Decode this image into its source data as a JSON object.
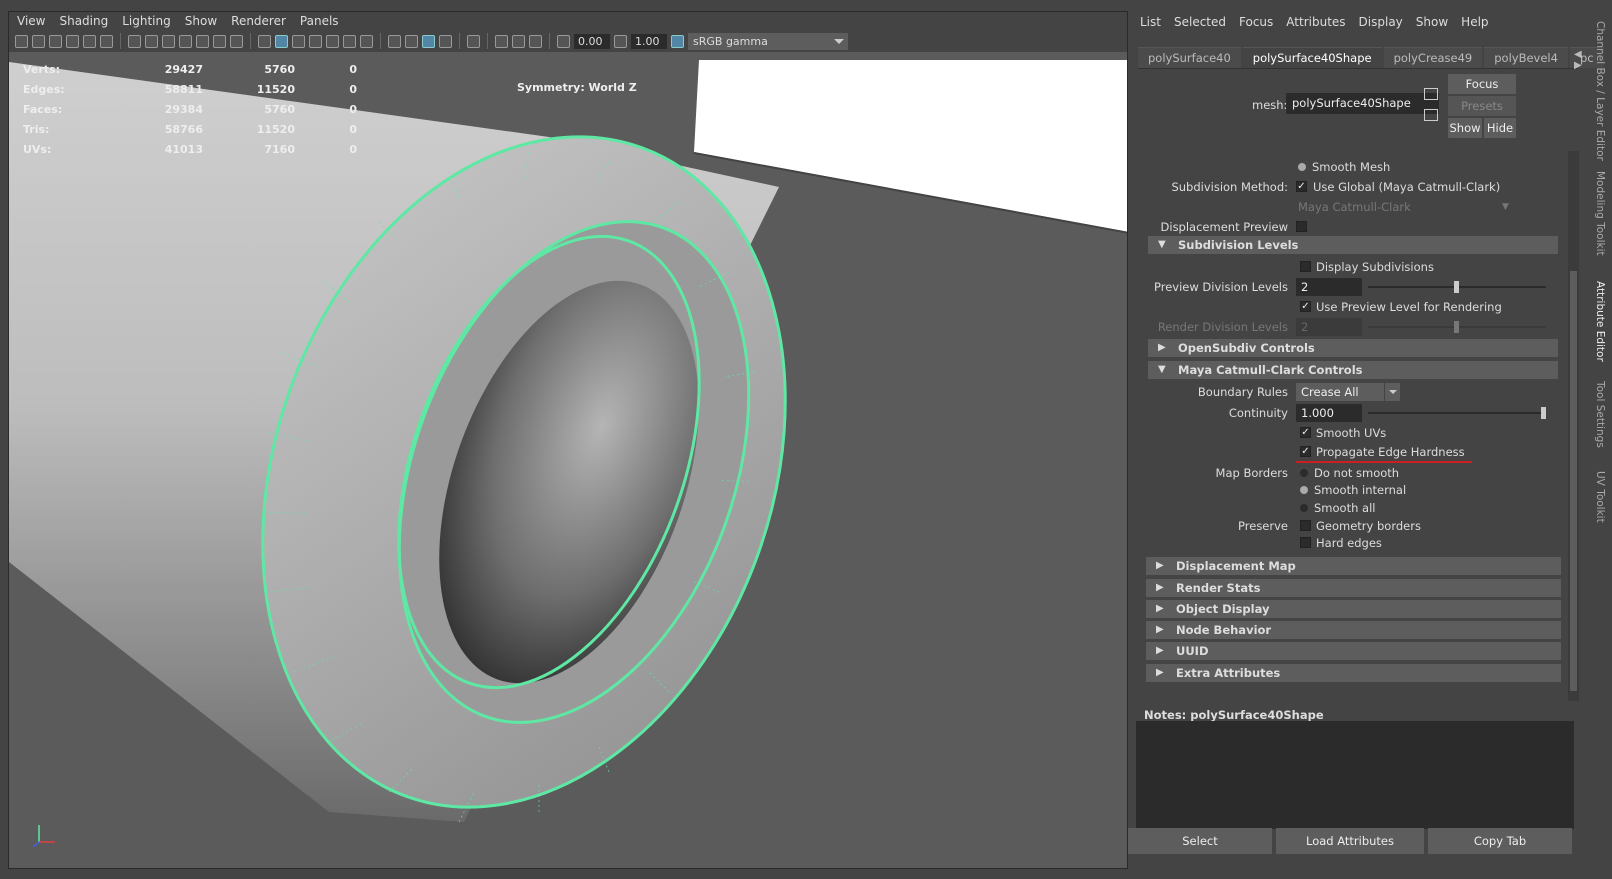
{
  "viewport": {
    "menu": [
      "View",
      "Shading",
      "Lighting",
      "Show",
      "Renderer",
      "Panels"
    ],
    "toolbar": {
      "field1": "0.00",
      "field2": "1.00",
      "color_space": "sRGB gamma"
    },
    "hud": {
      "rows": [
        {
          "label": "Verts:",
          "a": "29427",
          "b": "5760",
          "c": "0"
        },
        {
          "label": "Edges:",
          "a": "58811",
          "b": "11520",
          "c": "0"
        },
        {
          "label": "Faces:",
          "a": "29384",
          "b": "5760",
          "c": "0"
        },
        {
          "label": "Tris:",
          "a": "58766",
          "b": "11520",
          "c": "0"
        },
        {
          "label": "UVs:",
          "a": "41013",
          "b": "7160",
          "c": "0"
        }
      ],
      "symmetry": "Symmetry: World Z"
    },
    "axis_labels": {
      "x": "x",
      "y": "y",
      "z": "z"
    }
  },
  "attribute_editor": {
    "menu": [
      "List",
      "Selected",
      "Focus",
      "Attributes",
      "Display",
      "Show",
      "Help"
    ],
    "tabs": [
      "polySurface40",
      "polySurface40Shape",
      "polyCrease49",
      "polyBevel4",
      "pc"
    ],
    "active_tab": "polySurface40Shape",
    "mesh_label": "mesh:",
    "mesh_value": "polySurface40Shape",
    "buttons": {
      "focus": "Focus",
      "presets": "Presets",
      "show": "Show",
      "hide": "Hide"
    },
    "rows": {
      "smooth_mesh": "Smooth Mesh",
      "subdiv_method_label": "Subdivision Method:",
      "use_global": "Use Global (Maya Catmull-Clark)",
      "maya_cc": "Maya Catmull-Clark",
      "displacement_preview": "Displacement Preview",
      "subdiv_levels": "Subdivision Levels",
      "display_subdivisions": "Display Subdivisions",
      "preview_div_label": "Preview Division Levels",
      "preview_div_value": "2",
      "use_preview_level": "Use Preview Level for Rendering",
      "render_div_label": "Render Division Levels",
      "render_div_value": "2",
      "opensubdiv": "OpenSubdiv Controls",
      "maya_cc_controls": "Maya Catmull-Clark Controls",
      "boundary_label": "Boundary Rules",
      "boundary_value": "Crease All",
      "continuity_label": "Continuity",
      "continuity_value": "1.000",
      "smooth_uvs": "Smooth UVs",
      "propagate": "Propagate Edge Hardness",
      "map_borders_label": "Map Borders",
      "do_not_smooth": "Do not smooth",
      "smooth_internal": "Smooth internal",
      "smooth_all": "Smooth all",
      "preserve_label": "Preserve",
      "geometry_borders": "Geometry borders",
      "hard_edges": "Hard edges"
    },
    "collapsed_frames": [
      "Displacement Map",
      "Render Stats",
      "Object Display",
      "Node Behavior",
      "UUID",
      "Extra Attributes"
    ],
    "notes_label": "Notes:  polySurface40Shape",
    "bottom_buttons": [
      "Select",
      "Load Attributes",
      "Copy Tab"
    ]
  },
  "side_tabs": [
    "Channel Box / Layer Editor",
    "Modeling Toolkit",
    "Attribute Editor",
    "Tool Settings",
    "UV Toolkit"
  ],
  "colors": {
    "selection": "#5ee8a4",
    "annotation": "#cc1f1f",
    "accent": "#5285a6"
  }
}
